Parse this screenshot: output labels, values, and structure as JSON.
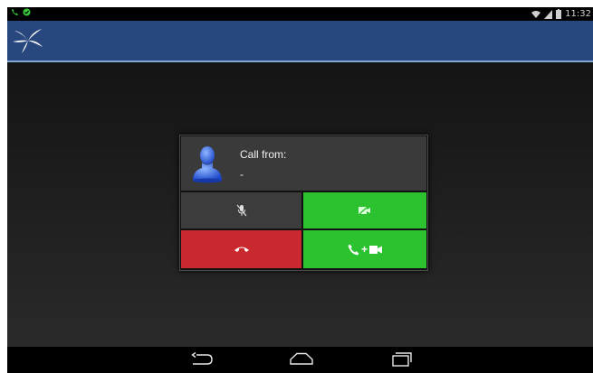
{
  "status_bar": {
    "time": "11:32",
    "icons": [
      "phone-call-icon",
      "check-circle-icon",
      "wifi-icon",
      "signal-icon",
      "battery-icon"
    ]
  },
  "action_bar": {
    "logo": "star-logo-icon"
  },
  "dialog": {
    "title": "Call from:",
    "caller": "-",
    "buttons": {
      "mute": {
        "icon": "mic-off-icon"
      },
      "video": {
        "icon": "video-off-icon"
      },
      "hangup": {
        "icon": "hangup-icon"
      },
      "accept_video": {
        "icon": "phone-video-icon",
        "plus": "+"
      }
    }
  },
  "nav": [
    "back-icon",
    "home-icon",
    "recents-icon"
  ],
  "colors": {
    "action_bar": "#27477e",
    "green": "#2cc22f",
    "red": "#c9282f",
    "dark_button": "#3c3c3c"
  }
}
